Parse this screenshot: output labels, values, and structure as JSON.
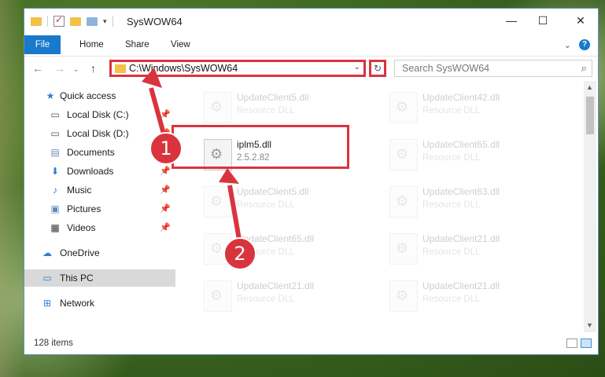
{
  "window": {
    "title": "SysWOW64",
    "controls": {
      "minimize": "—",
      "maximize": "☐",
      "close": "✕"
    }
  },
  "ribbon": {
    "tabs": [
      {
        "label": "File"
      },
      {
        "label": "Home"
      },
      {
        "label": "Share"
      },
      {
        "label": "View"
      }
    ],
    "expand_icon": "chevron-down-icon",
    "help_label": "?"
  },
  "address": {
    "path": "C:\\Windows\\SysWOW64",
    "search_placeholder": "Search SysWOW64"
  },
  "nav": {
    "items": [
      {
        "label": "Quick access",
        "icon": "star-icon",
        "pinned": false
      },
      {
        "label": "Local Disk (C:)",
        "icon": "drive-icon",
        "pinned": true
      },
      {
        "label": "Local Disk (D:)",
        "icon": "drive-icon",
        "pinned": true
      },
      {
        "label": "Documents",
        "icon": "documents-icon",
        "pinned": true
      },
      {
        "label": "Downloads",
        "icon": "download-icon",
        "pinned": true
      },
      {
        "label": "Music",
        "icon": "music-icon",
        "pinned": true
      },
      {
        "label": "Pictures",
        "icon": "pictures-icon",
        "pinned": true
      },
      {
        "label": "Videos",
        "icon": "videos-icon",
        "pinned": true
      },
      {
        "label": "OneDrive",
        "icon": "cloud-icon",
        "pinned": false
      },
      {
        "label": "This PC",
        "icon": "computer-icon",
        "pinned": false,
        "selected": true
      },
      {
        "label": "Network",
        "icon": "network-icon",
        "pinned": false
      }
    ]
  },
  "files": [
    {
      "name": "UpdateClient5.dll",
      "desc": "Resource DLL",
      "faded": true
    },
    {
      "name": "UpdateClient42.dll",
      "desc": "Resource DLL",
      "faded": true
    },
    {
      "name": "iplm5.dll",
      "desc": "2.5.2.82",
      "faded": false,
      "highlighted": true
    },
    {
      "name": "UpdateClient65.dll",
      "desc": "Resource DLL",
      "faded": true
    },
    {
      "name": "UpdateClient5.dll",
      "desc": "Resource DLL",
      "faded": true
    },
    {
      "name": "UpdateClient63.dll",
      "desc": "Resource DLL",
      "faded": true
    },
    {
      "name": "UpdateClient65.dll",
      "desc": "Resource DLL",
      "faded": true
    },
    {
      "name": "UpdateClient21.dll",
      "desc": "Resource DLL",
      "faded": true
    },
    {
      "name": "UpdateClient21.dll",
      "desc": "Resource DLL",
      "faded": true
    },
    {
      "name": "UpdateClient21.dll",
      "desc": "Resource DLL",
      "faded": true
    }
  ],
  "status": {
    "item_count": "128 items"
  },
  "annotations": {
    "badge1": "1",
    "badge2": "2",
    "accent_color": "#d9343e"
  }
}
